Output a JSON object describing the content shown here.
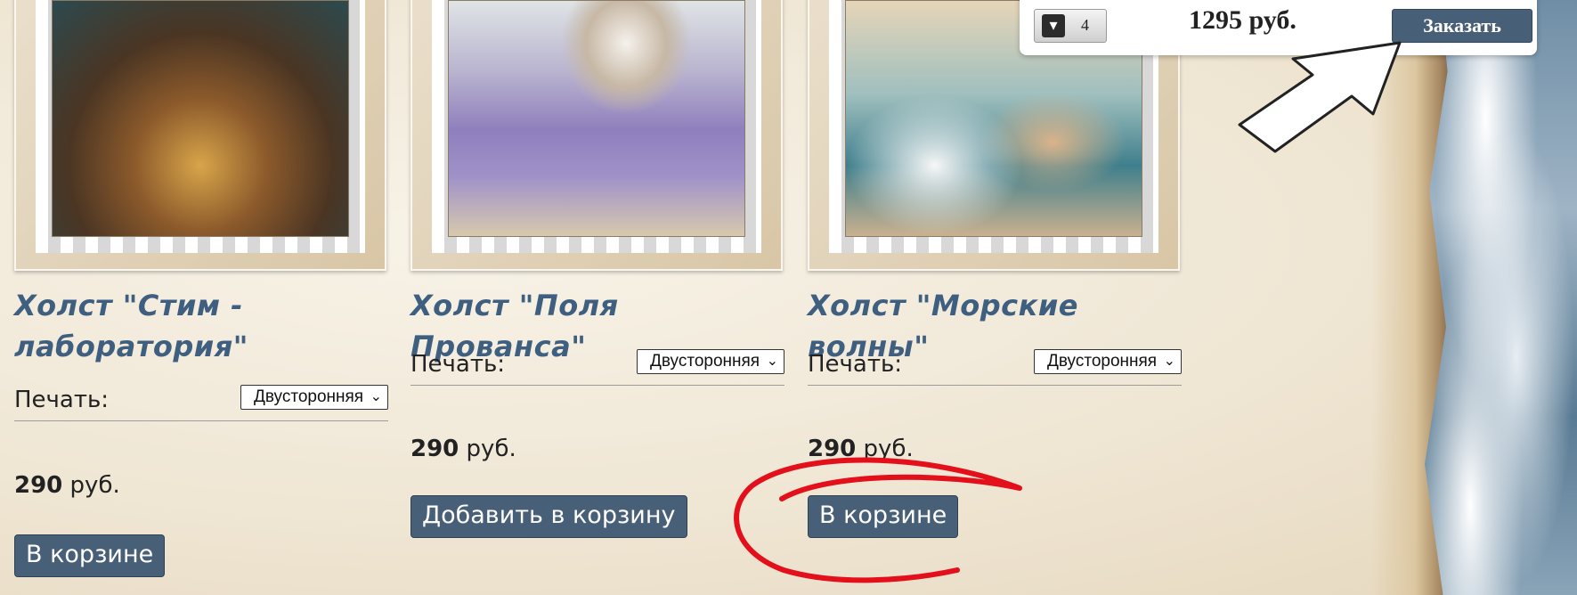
{
  "products": [
    {
      "title_line1": "Холст \"Стим -",
      "title_line2": "лаборатория\"",
      "print_label": "Печать:",
      "print_value": "Двусторонняя",
      "price_value": "290",
      "price_currency": "руб.",
      "button_label": "В корзине"
    },
    {
      "title_line1": "Холст \"Поля Прованса\"",
      "print_label": "Печать:",
      "print_value": "Двусторонняя",
      "price_value": "290",
      "price_currency": "руб.",
      "button_label": "Добавить в корзину"
    },
    {
      "title_line1": "Холст \"Морские волны\"",
      "print_label": "Печать:",
      "print_value": "Двусторонняя",
      "price_value": "290",
      "price_currency": "руб.",
      "button_label": "В корзине"
    }
  ],
  "cart": {
    "count": "4",
    "total": "1295 руб.",
    "order_label": "Заказать",
    "icon": "basket-icon"
  },
  "annotations": {
    "arrow_color": "#ffffff",
    "circle_color": "#e3101c"
  }
}
